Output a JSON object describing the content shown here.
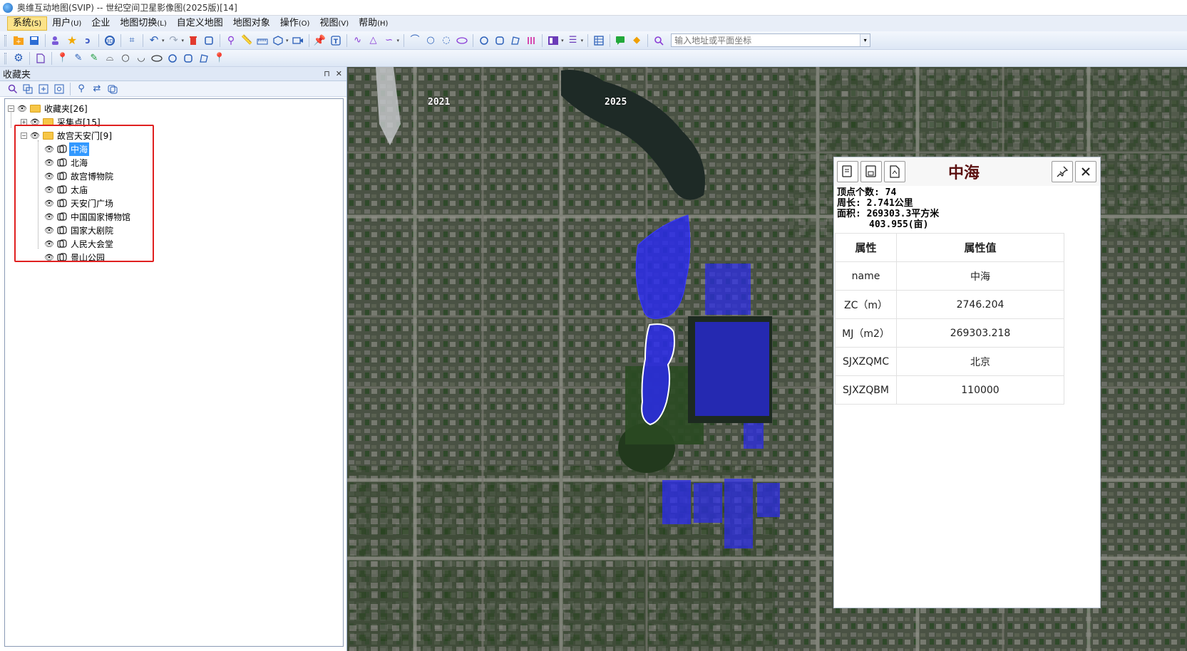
{
  "window": {
    "title": "奥维互动地图(SVIP) -- 世纪空间卫星影像图(2025版)[14]"
  },
  "menu": [
    {
      "label": "系统",
      "key": "(S)",
      "active": true
    },
    {
      "label": "用户",
      "key": "(U)"
    },
    {
      "label": "企业",
      "key": ""
    },
    {
      "label": "地图切换",
      "key": "(L)"
    },
    {
      "label": "自定义地图",
      "key": ""
    },
    {
      "label": "地图对象",
      "key": ""
    },
    {
      "label": "操作",
      "key": "(O)"
    },
    {
      "label": "视图",
      "key": "(V)"
    },
    {
      "label": "帮助",
      "key": "(H)"
    }
  ],
  "toolbar": {
    "address_placeholder": "输入地址或平面坐标",
    "icons": [
      "open-icon",
      "save-icon",
      "user-icon",
      "star-icon",
      "link-icon",
      "globe-3d-icon",
      "crop-icon",
      "undo-icon",
      "redo-icon",
      "delete-icon",
      "select-icon",
      "marker-icon",
      "ruler-icon",
      "measure-area-icon",
      "cube-icon",
      "video-icon",
      "pin-icon",
      "text-icon",
      "polyline-icon",
      "triangle-icon",
      "curve-icon",
      "arc-icon",
      "circle-icon",
      "arc2-icon",
      "ellipse-icon",
      "circle-fill-icon",
      "square-icon",
      "shape-icon",
      "bars-icon",
      "layout-icon",
      "list-icon",
      "table-icon",
      "chat-icon",
      "gem-icon",
      "search-icon"
    ]
  },
  "panel": {
    "title": "收藏夹",
    "pin": "⊓",
    "close": "✕"
  },
  "tree": {
    "root": "收藏夹[26]",
    "folder1": "采集点[15]",
    "folder2": "故宫天安门[9]",
    "items": [
      "中海",
      "北海",
      "故宫博物院",
      "太庙",
      "天安门广场",
      "中国国家博物馆",
      "国家大剧院",
      "人民大会堂",
      "景山公园"
    ]
  },
  "map": {
    "year_left": "2021",
    "year_right": "2025",
    "polygon_color": "#2a2af0"
  },
  "popup": {
    "title": "中海",
    "vertex_count": "顶点个数: 74",
    "perimeter": "周长: 2.741公里",
    "area": "面积: 269303.3平方米",
    "area_mu": "403.955(亩)",
    "headers": [
      "属性",
      "属性值"
    ],
    "rows": [
      {
        "k": "name",
        "v": "中海"
      },
      {
        "k": "ZC（m）",
        "v": "2746.204"
      },
      {
        "k": "MJ（m2）",
        "v": "269303.218"
      },
      {
        "k": "SJXZQMC",
        "v": "北京"
      },
      {
        "k": "SJXZQBM",
        "v": "110000"
      }
    ]
  }
}
